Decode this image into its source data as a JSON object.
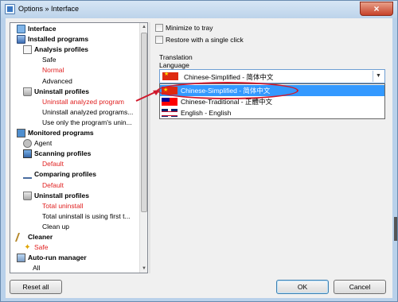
{
  "window": {
    "title": "Options » Interface",
    "close_glyph": "×"
  },
  "tree": {
    "nodes": [
      {
        "label": "Interface",
        "icon": "monitor-icon",
        "bold": true
      },
      {
        "label": "Installed programs",
        "icon": "box-icon",
        "bold": true
      },
      {
        "label": "Analysis profiles",
        "icon": "document-icon",
        "bold": true
      },
      {
        "label": "Safe"
      },
      {
        "label": "Normal",
        "red": true
      },
      {
        "label": "Advanced"
      },
      {
        "label": "Uninstall profiles",
        "icon": "trash-icon",
        "bold": true
      },
      {
        "label": "Uninstall analyzed program",
        "red": true
      },
      {
        "label": "Uninstall analyzed programs..."
      },
      {
        "label": "Use only the program's unin..."
      },
      {
        "label": "Monitored programs",
        "icon": "monitor-icon",
        "bold": true
      },
      {
        "label": "Agent",
        "icon": "agent-icon"
      },
      {
        "label": "Scanning profiles",
        "icon": "scan-icon",
        "bold": true
      },
      {
        "label": "Default",
        "red": true
      },
      {
        "label": "Comparing profiles",
        "icon": "scale-icon",
        "bold": true
      },
      {
        "label": "Default",
        "red": true
      },
      {
        "label": "Uninstall profiles",
        "icon": "trash-icon",
        "bold": true
      },
      {
        "label": "Total uninstall",
        "red": true
      },
      {
        "label": "Total uninstall is using first t..."
      },
      {
        "label": "Clean up"
      },
      {
        "label": "Cleaner",
        "icon": "broom-icon",
        "bold": true
      },
      {
        "label": "Safe",
        "icon": "sparkle-icon",
        "red": true
      },
      {
        "label": "Auto-run manager",
        "icon": "autorun-icon",
        "bold": true
      },
      {
        "label": "All"
      }
    ]
  },
  "options": {
    "minimize_to_tray": "Minimize to tray",
    "restore_single_click": "Restore with a single click"
  },
  "translation": {
    "group_title": "Translation",
    "language_label": "Language",
    "selected": "Chinese-Simplified - 简体中文",
    "options": [
      {
        "label": "Chinese-Simplified - 简体中文",
        "flag": "flag-cn",
        "highlighted": true
      },
      {
        "label": "Chinese-Traditional - 正體中文",
        "flag": "flag-tw",
        "highlighted": false
      },
      {
        "label": "English - English",
        "flag": "flag-gb",
        "highlighted": false
      }
    ]
  },
  "buttons": {
    "reset_all": "Reset all",
    "ok": "OK",
    "cancel": "Cancel"
  },
  "colors": {
    "highlight": "#3399ff",
    "red_text": "#e01f1f",
    "annotation": "#d0182b"
  }
}
